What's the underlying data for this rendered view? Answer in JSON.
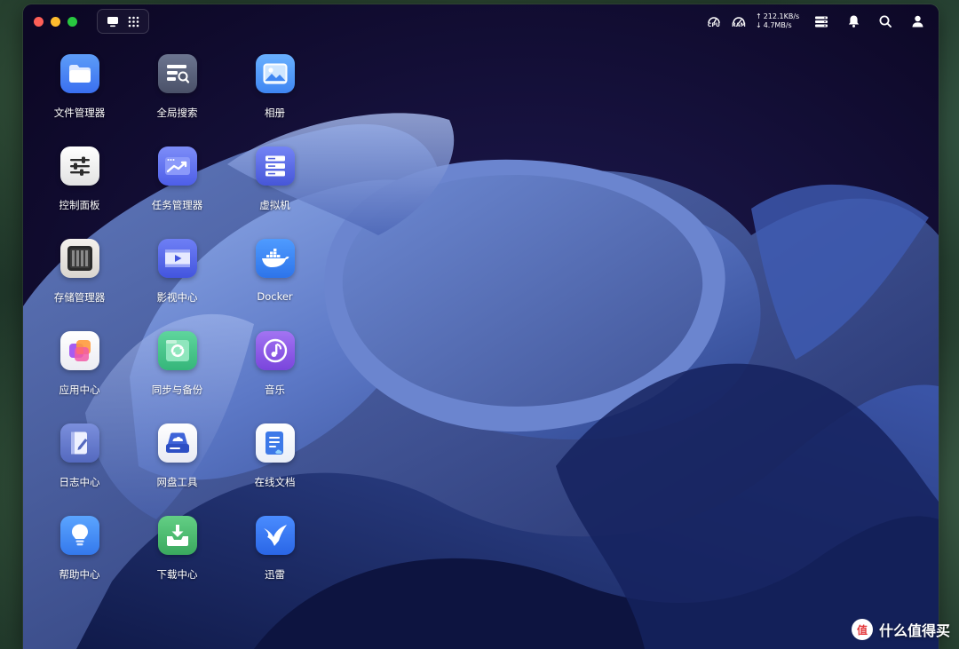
{
  "window": {
    "title_controls": [
      "close",
      "minimize",
      "zoom"
    ]
  },
  "topbar": {
    "view_switch": [
      "desktop-icon",
      "app-grid-icon"
    ],
    "cpu_label": "CPU",
    "ram_label": "RAM",
    "upload": "212.1KB/s",
    "download": "4.7MB/s",
    "icons": [
      "menu-list-icon",
      "bell-icon",
      "search-icon",
      "user-icon"
    ]
  },
  "apps": [
    {
      "label": "文件管理器",
      "icon": "folder-icon",
      "color": "#3e8bf6"
    },
    {
      "label": "全局搜索",
      "icon": "global-search-icon",
      "color": "#596279"
    },
    {
      "label": "相册",
      "icon": "photo-album-icon",
      "color": "#4b9cf7"
    },
    {
      "label": "控制面板",
      "icon": "sliders-icon",
      "color": "#f2f2f2"
    },
    {
      "label": "任务管理器",
      "icon": "trend-chart-icon",
      "color": "#5c6ff0"
    },
    {
      "label": "虚拟机",
      "icon": "server-stack-icon",
      "color": "#5a6ce6"
    },
    {
      "label": "存储管理器",
      "icon": "storage-bays-icon",
      "color": "#e9e6e2"
    },
    {
      "label": "影视中心",
      "icon": "video-play-icon",
      "color": "#5064ea"
    },
    {
      "label": "Docker",
      "icon": "docker-whale-icon",
      "color": "#3a86f0"
    },
    {
      "label": "应用中心",
      "icon": "app-store-icon",
      "color": "#f4f2f6"
    },
    {
      "label": "同步与备份",
      "icon": "sync-icon",
      "color": "#45c28a"
    },
    {
      "label": "音乐",
      "icon": "music-note-icon",
      "color": "#8d5be8"
    },
    {
      "label": "日志中心",
      "icon": "log-pen-icon",
      "color": "#5e73c9"
    },
    {
      "label": "网盘工具",
      "icon": "cloud-drive-icon",
      "color": "#f2f3f7"
    },
    {
      "label": "在线文档",
      "icon": "online-doc-icon",
      "color": "#f5f7fb"
    },
    {
      "label": "帮助中心",
      "icon": "lightbulb-icon",
      "color": "#3f8ff3"
    },
    {
      "label": "下载中心",
      "icon": "download-tray-icon",
      "color": "#48bb6b"
    },
    {
      "label": "迅雷",
      "icon": "thunder-bird-icon",
      "color": "#3478ef"
    }
  ],
  "watermark": {
    "logo_text": "值",
    "text": "什么值得买"
  }
}
